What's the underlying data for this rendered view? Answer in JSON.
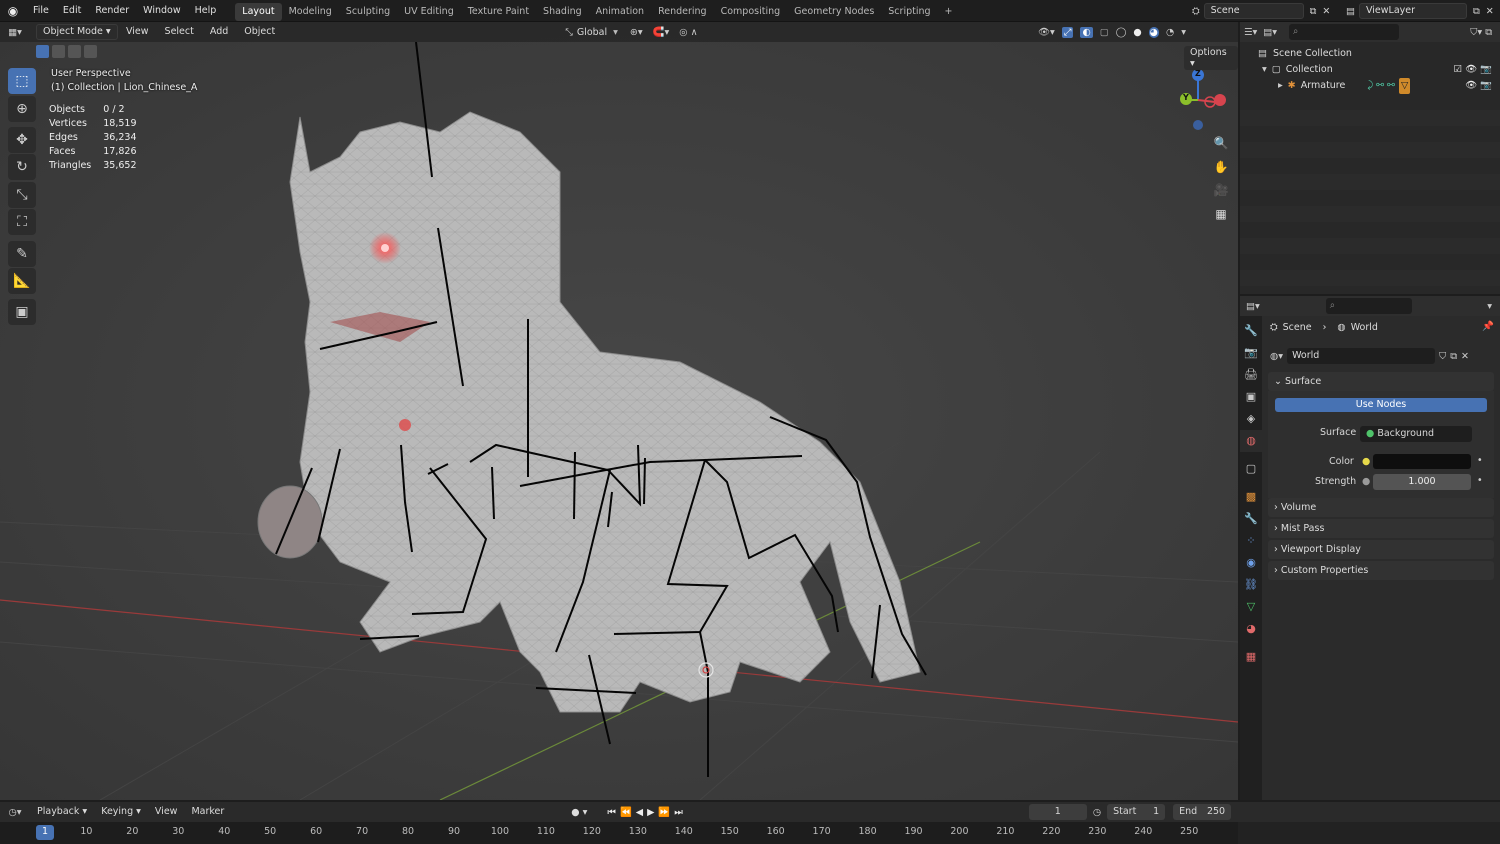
{
  "topbar": {
    "menus": [
      "File",
      "Edit",
      "Render",
      "Window",
      "Help"
    ],
    "workspaces": [
      "Layout",
      "Modeling",
      "Sculpting",
      "UV Editing",
      "Texture Paint",
      "Shading",
      "Animation",
      "Rendering",
      "Compositing",
      "Geometry Nodes",
      "Scripting"
    ],
    "active_workspace": "Layout",
    "add_tab": "+",
    "scene": "Scene",
    "view_layer": "ViewLayer"
  },
  "viewport": {
    "mode": "Object Mode",
    "menus": [
      "View",
      "Select",
      "Add",
      "Object"
    ],
    "orientation": "Global",
    "options": "Options",
    "view_name": "User Perspective",
    "collection_line": "(1) Collection | Lion_Chinese_A",
    "stats": [
      {
        "label": "Objects",
        "value": "0 / 2"
      },
      {
        "label": "Vertices",
        "value": "18,519"
      },
      {
        "label": "Edges",
        "value": "36,234"
      },
      {
        "label": "Faces",
        "value": "17,826"
      },
      {
        "label": "Triangles",
        "value": "35,652"
      }
    ],
    "gizmo": {
      "z": "Z",
      "y": "Y"
    }
  },
  "outliner": {
    "search_placeholder": "",
    "scene_collection": "Scene Collection",
    "collection": "Collection",
    "armature": "Armature"
  },
  "properties": {
    "breadcrumb_scene": "Scene",
    "breadcrumb_world": "World",
    "world_name": "World",
    "surface_panel": "Surface",
    "use_nodes": "Use Nodes",
    "surface_label": "Surface",
    "surface_value": "Background",
    "color_label": "Color",
    "strength_label": "Strength",
    "strength_value": "1.000",
    "panels": [
      "Volume",
      "Mist Pass",
      "Viewport Display",
      "Custom Properties"
    ]
  },
  "timeline": {
    "menus": [
      "Playback",
      "Keying",
      "View",
      "Marker"
    ],
    "current_frame": "1",
    "start_label": "Start",
    "start_value": "1",
    "end_label": "End",
    "end_value": "250",
    "ticks": [
      "1",
      "10",
      "20",
      "30",
      "40",
      "50",
      "60",
      "70",
      "80",
      "90",
      "100",
      "110",
      "120",
      "130",
      "140",
      "150",
      "160",
      "170",
      "180",
      "190",
      "200",
      "210",
      "220",
      "230",
      "240",
      "250"
    ]
  }
}
